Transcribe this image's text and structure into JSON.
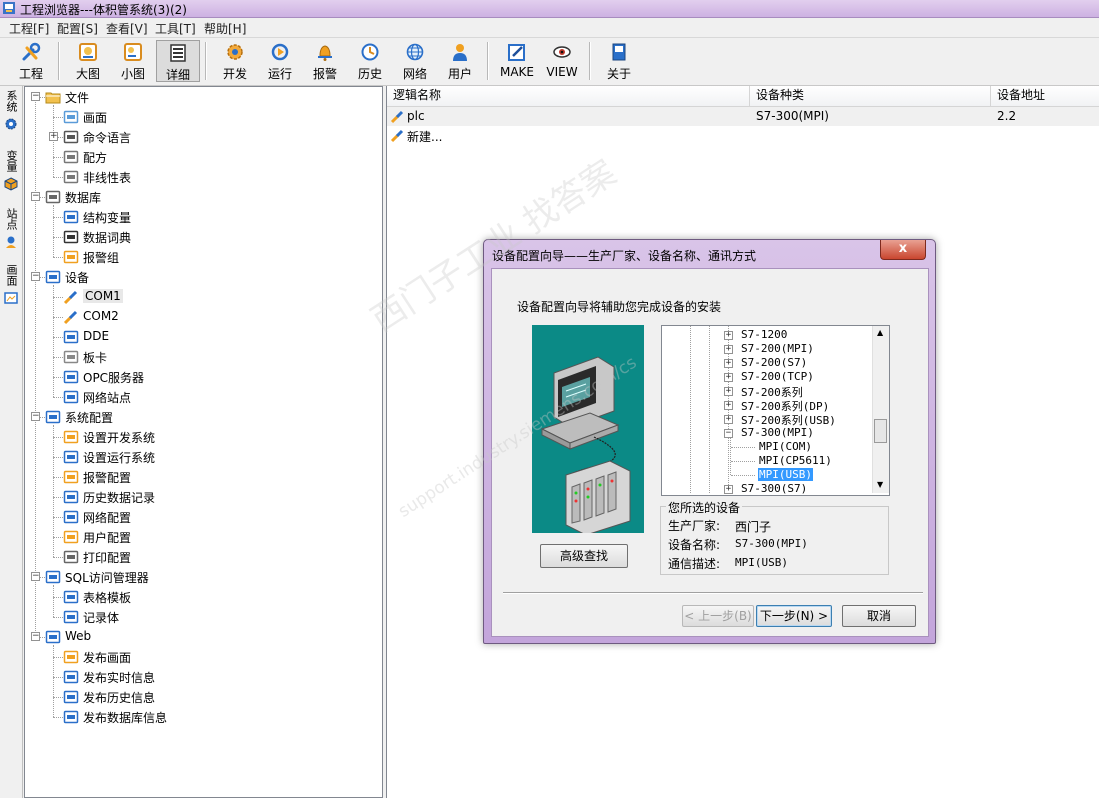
{
  "window": {
    "title": "工程浏览器---体积管系统(3)(2)"
  },
  "menu": [
    {
      "label": "工程[F]"
    },
    {
      "label": "配置[S]"
    },
    {
      "label": "查看[V]"
    },
    {
      "label": "工具[T]"
    },
    {
      "label": "帮助[H]"
    }
  ],
  "toolbar": [
    {
      "label": "工程",
      "icon": "wrench-icon"
    },
    {
      "label": "大图",
      "icon": "large-icons-icon"
    },
    {
      "label": "小图",
      "icon": "small-icons-icon"
    },
    {
      "label": "详细",
      "icon": "details-icon"
    },
    {
      "label": "开发",
      "icon": "develop-gear-icon"
    },
    {
      "label": "运行",
      "icon": "run-icon"
    },
    {
      "label": "报警",
      "icon": "alarm-bell-icon"
    },
    {
      "label": "历史",
      "icon": "history-clock-icon"
    },
    {
      "label": "网络",
      "icon": "network-globe-icon"
    },
    {
      "label": "用户",
      "icon": "user-icon"
    },
    {
      "label": "MAKE",
      "icon": "make-edit-icon"
    },
    {
      "label": "VIEW",
      "icon": "view-eye-icon"
    },
    {
      "label": "关于",
      "icon": "about-book-icon"
    }
  ],
  "side_tabs": [
    {
      "label": "系统"
    },
    {
      "label": "变量"
    },
    {
      "label": "站点"
    },
    {
      "label": "画面"
    }
  ],
  "tree": [
    {
      "label": "文件",
      "level": 0,
      "expander": "−",
      "icon": "folder-icon"
    },
    {
      "label": "画面",
      "level": 1,
      "icon": "screen-icon"
    },
    {
      "label": "命令语言",
      "level": 1,
      "expander": "+",
      "icon": "command-icon"
    },
    {
      "label": "配方",
      "level": 1,
      "icon": "recipe-icon"
    },
    {
      "label": "非线性表",
      "level": 1,
      "icon": "nonlinear-table-icon"
    },
    {
      "label": "数据库",
      "level": 0,
      "expander": "−",
      "icon": "database-icon"
    },
    {
      "label": "结构变量",
      "level": 1,
      "icon": "struct-variable-icon"
    },
    {
      "label": "数据词典",
      "level": 1,
      "icon": "data-dictionary-icon"
    },
    {
      "label": "报警组",
      "level": 1,
      "icon": "alarm-group-icon"
    },
    {
      "label": "设备",
      "level": 0,
      "expander": "−",
      "icon": "device-monitor-icon"
    },
    {
      "label": "COM1",
      "level": 1,
      "icon": "com-plug-icon"
    },
    {
      "label": "COM2",
      "level": 1,
      "icon": "com-plug-icon"
    },
    {
      "label": "DDE",
      "level": 1,
      "icon": "dde-icon"
    },
    {
      "label": "板卡",
      "level": 1,
      "icon": "board-card-icon"
    },
    {
      "label": "OPC服务器",
      "level": 1,
      "icon": "opc-server-icon"
    },
    {
      "label": "网络站点",
      "level": 1,
      "icon": "network-station-icon"
    },
    {
      "label": "系统配置",
      "level": 0,
      "expander": "−",
      "icon": "system-config-icon"
    },
    {
      "label": "设置开发系统",
      "level": 1,
      "icon": "develop-gear-icon"
    },
    {
      "label": "设置运行系统",
      "level": 1,
      "icon": "run-icon"
    },
    {
      "label": "报警配置",
      "level": 1,
      "icon": "alarm-bell-icon"
    },
    {
      "label": "历史数据记录",
      "level": 1,
      "icon": "history-clock-icon"
    },
    {
      "label": "网络配置",
      "level": 1,
      "icon": "network-globe-icon"
    },
    {
      "label": "用户配置",
      "level": 1,
      "icon": "user-icon"
    },
    {
      "label": "打印配置",
      "level": 1,
      "icon": "print-icon"
    },
    {
      "label": "SQL访问管理器",
      "level": 0,
      "expander": "−",
      "icon": "sql-manager-icon"
    },
    {
      "label": "表格模板",
      "level": 1,
      "icon": "table-template-icon"
    },
    {
      "label": "记录体",
      "level": 1,
      "icon": "record-icon"
    },
    {
      "label": "Web",
      "level": 0,
      "expander": "−",
      "icon": "web-icon"
    },
    {
      "label": "发布画面",
      "level": 1,
      "icon": "publish-screen-icon"
    },
    {
      "label": "发布实时信息",
      "level": 1,
      "icon": "publish-realtime-icon"
    },
    {
      "label": "发布历史信息",
      "level": 1,
      "icon": "publish-history-icon"
    },
    {
      "label": "发布数据库信息",
      "level": 1,
      "icon": "publish-database-icon"
    }
  ],
  "list": {
    "columns": [
      "逻辑名称",
      "设备种类",
      "设备地址"
    ],
    "rows": [
      {
        "name": "plc",
        "type": "S7-300(MPI)",
        "address": "2.2"
      },
      {
        "name": "新建...",
        "type": "",
        "address": ""
      }
    ]
  },
  "dialog": {
    "title": "设备配置向导——生产厂家、设备名称、通讯方式",
    "close": "x",
    "intro": "设备配置向导将辅助您完成设备的安装",
    "advanced_search": "高级查找",
    "tree_items": [
      {
        "label": "S7-1200",
        "expander": "+"
      },
      {
        "label": "S7-200(MPI)",
        "expander": "+"
      },
      {
        "label": "S7-200(S7)",
        "expander": "+"
      },
      {
        "label": "S7-200(TCP)",
        "expander": "+"
      },
      {
        "label": "S7-200系列",
        "expander": "+"
      },
      {
        "label": "S7-200系列(DP)",
        "expander": "+"
      },
      {
        "label": "S7-200系列(USB)",
        "expander": "+"
      },
      {
        "label": "S7-300(MPI)",
        "expander": "−"
      },
      {
        "label": "MPI(COM)",
        "leaf": true
      },
      {
        "label": "MPI(CP5611)",
        "leaf": true
      },
      {
        "label": "MPI(USB)",
        "leaf": true,
        "selected": true
      },
      {
        "label": "S7-300(S7)",
        "expander": "+"
      }
    ],
    "selection": {
      "group_title": "您所选的设备",
      "manufacturer_label": "生产厂家:",
      "manufacturer": "西门子",
      "device_label": "设备名称:",
      "device": "S7-300(MPI)",
      "comm_label": "通信描述:",
      "comm": "MPI(USB)"
    },
    "buttons": {
      "prev": "< 上一步(B)",
      "next": "下一步(N) >",
      "cancel": "取消"
    },
    "watermark": "西门子工业 找答案",
    "watermark_url": "support.industry.siemens.com/cs"
  },
  "colors": {
    "accent": "#3399ff",
    "titlebar": "#d6bfe8",
    "dialog_pic_bg": "#0b8a86"
  }
}
